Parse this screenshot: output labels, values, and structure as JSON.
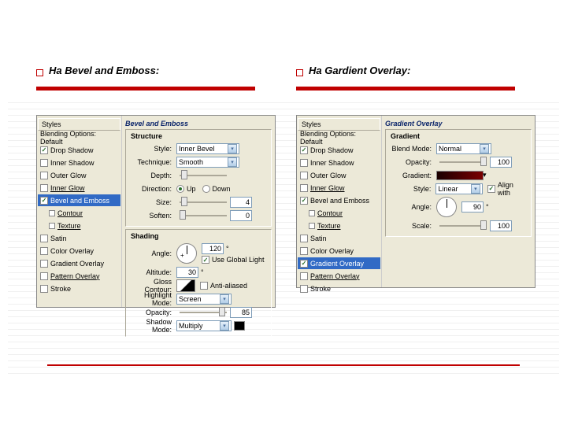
{
  "headers": {
    "left": "На Bevel and Emboss:",
    "right": "На Gardient Overlay:"
  },
  "left_panel": {
    "styles_head": "Styles",
    "styles": [
      {
        "label": "Blending Options: Default",
        "checked": null
      },
      {
        "label": "Drop Shadow",
        "checked": true
      },
      {
        "label": "Inner Shadow",
        "checked": false
      },
      {
        "label": "Outer Glow",
        "checked": false
      },
      {
        "label": "Inner Glow",
        "checked": false,
        "underline": true
      },
      {
        "label": "Bevel and Emboss",
        "checked": true,
        "active": true
      },
      {
        "label": "Contour",
        "checked": false,
        "indent": true,
        "underline": true
      },
      {
        "label": "Texture",
        "checked": false,
        "indent": true,
        "underline": true
      },
      {
        "label": "Satin",
        "checked": false
      },
      {
        "label": "Color Overlay",
        "checked": false
      },
      {
        "label": "Gradient Overlay",
        "checked": false
      },
      {
        "label": "Pattern Overlay",
        "checked": false,
        "underline": true
      },
      {
        "label": "Stroke",
        "checked": false
      }
    ],
    "section_title": "Bevel and Emboss",
    "structure_title": "Structure",
    "structure": {
      "style_label": "Style:",
      "style_value": "Inner Bevel",
      "technique_label": "Technique:",
      "technique_value": "Smooth",
      "depth_label": "Depth:",
      "direction_label": "Direction:",
      "dir_up": "Up",
      "dir_down": "Down",
      "size_label": "Size:",
      "size_value": "4",
      "soften_label": "Soften:",
      "soften_value": "0"
    },
    "shading_title": "Shading",
    "shading": {
      "angle_label": "Angle:",
      "angle_value": "120",
      "global_label": "Use Global Light",
      "altitude_label": "Altitude:",
      "altitude_value": "30",
      "gloss_label": "Gloss Contour:",
      "antialias_label": "Anti-aliased",
      "highlight_label": "Highlight Mode:",
      "highlight_value": "Screen",
      "opacity_label": "Opacity:",
      "opacity_value": "85",
      "shadow_label": "Shadow Mode:",
      "shadow_value": "Multiply"
    }
  },
  "right_panel": {
    "styles_head": "Styles",
    "styles": [
      {
        "label": "Blending Options: Default",
        "checked": null
      },
      {
        "label": "Drop Shadow",
        "checked": true
      },
      {
        "label": "Inner Shadow",
        "checked": false
      },
      {
        "label": "Outer Glow",
        "checked": false
      },
      {
        "label": "Inner Glow",
        "checked": false,
        "underline": true
      },
      {
        "label": "Bevel and Emboss",
        "checked": true
      },
      {
        "label": "Contour",
        "checked": false,
        "indent": true,
        "underline": true
      },
      {
        "label": "Texture",
        "checked": false,
        "indent": true,
        "underline": true
      },
      {
        "label": "Satin",
        "checked": false
      },
      {
        "label": "Color Overlay",
        "checked": false
      },
      {
        "label": "Gradient Overlay",
        "checked": true,
        "active": true
      },
      {
        "label": "Pattern Overlay",
        "checked": false,
        "underline": true
      },
      {
        "label": "Stroke",
        "checked": false
      }
    ],
    "section_title": "Gradient Overlay",
    "group_title": "Gradient",
    "gradient": {
      "blend_label": "Blend Mode:",
      "blend_value": "Normal",
      "opacity_label": "Opacity:",
      "opacity_value": "100",
      "gradient_label": "Gradient:",
      "style_label": "Style:",
      "style_value": "Linear",
      "align_label": "Align with",
      "angle_label": "Angle:",
      "angle_value": "90",
      "scale_label": "Scale:",
      "scale_value": "100"
    }
  }
}
